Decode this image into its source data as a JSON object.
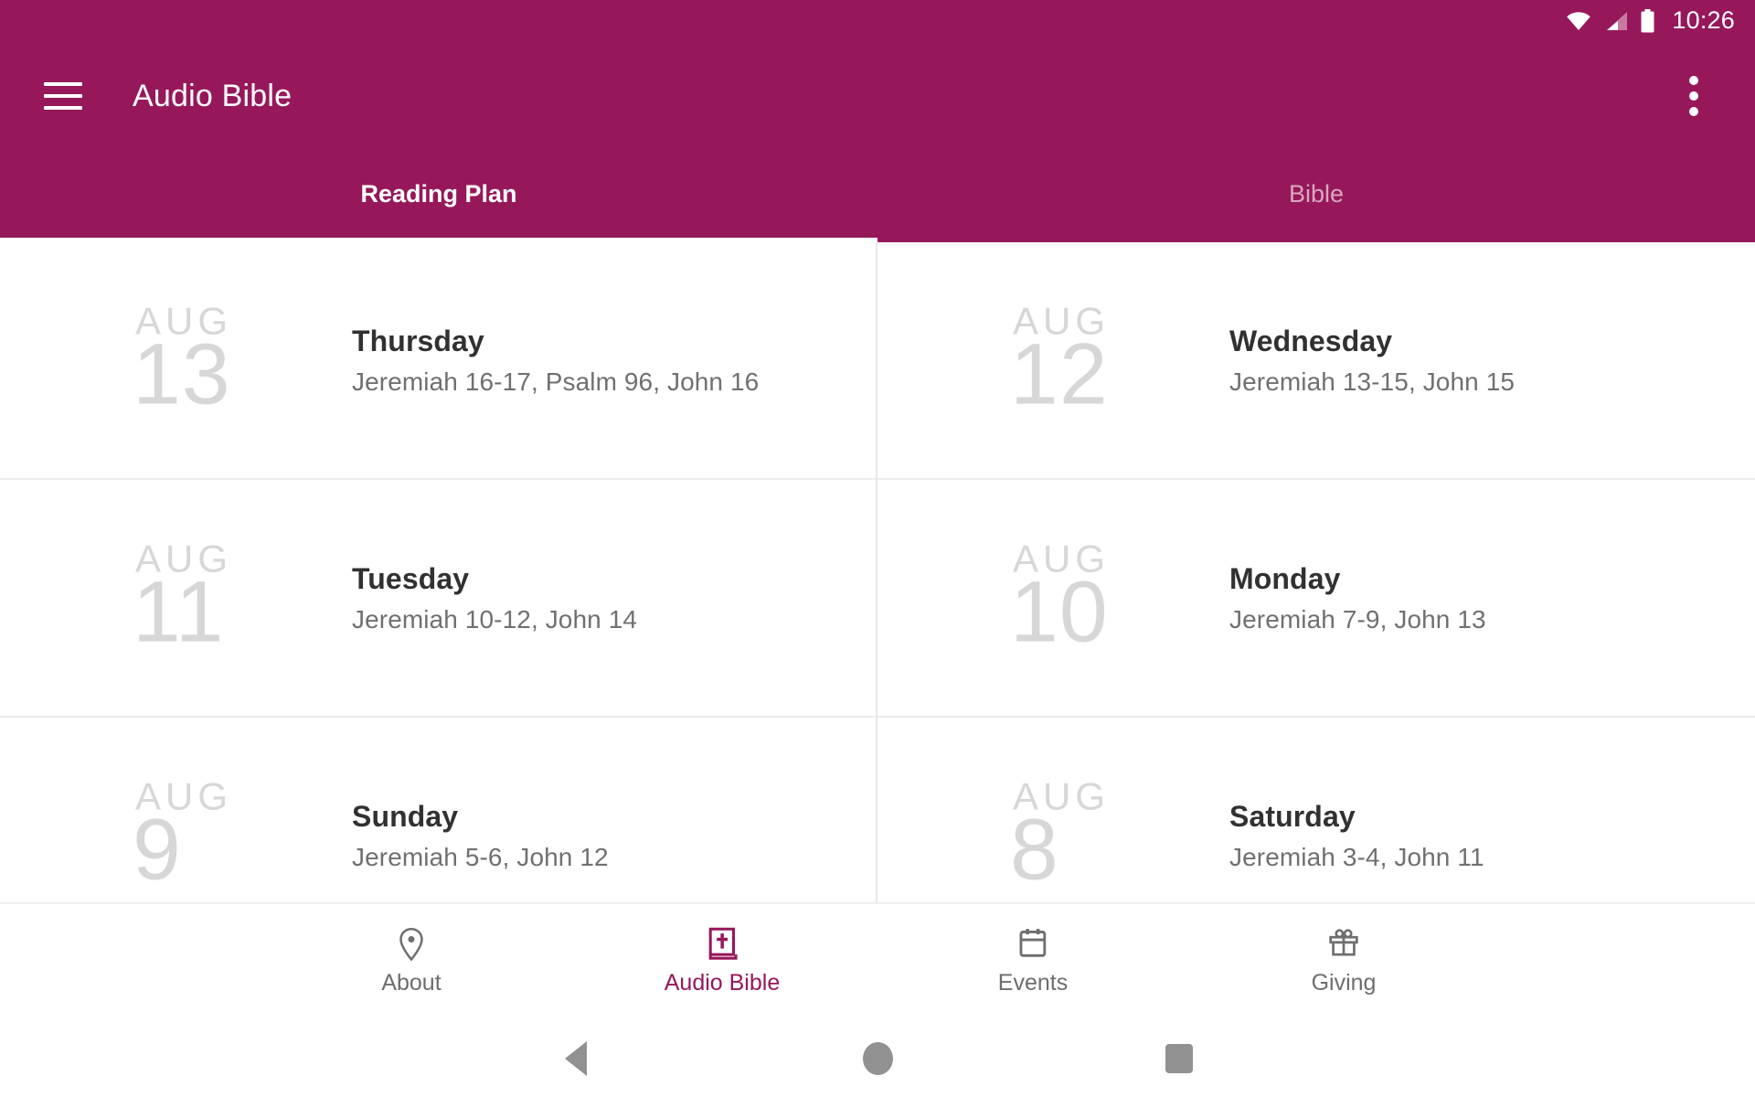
{
  "statusbar": {
    "time": "10:26",
    "icons": [
      "wifi-icon",
      "cellular-signal-icon",
      "battery-icon"
    ]
  },
  "toolbar": {
    "title": "Audio Bible",
    "menu_icon": "hamburger-menu-icon",
    "overflow_icon": "overflow-menu-icon",
    "background_color": "#96185B"
  },
  "tabs": {
    "items": [
      {
        "label": "Reading Plan",
        "active": true
      },
      {
        "label": "Bible",
        "active": false
      }
    ]
  },
  "reading_plan": {
    "entries": [
      {
        "month": "AUG",
        "day": "13",
        "weekday": "Thursday",
        "passages": "Jeremiah 16-17, Psalm 96, John 16"
      },
      {
        "month": "AUG",
        "day": "12",
        "weekday": "Wednesday",
        "passages": "Jeremiah 13-15, John 15"
      },
      {
        "month": "AUG",
        "day": "11",
        "weekday": "Tuesday",
        "passages": "Jeremiah 10-12, John 14"
      },
      {
        "month": "AUG",
        "day": "10",
        "weekday": "Monday",
        "passages": "Jeremiah 7-9, John 13"
      },
      {
        "month": "AUG",
        "day": "9",
        "weekday": "Sunday",
        "passages": "Jeremiah 5-6, John 12"
      },
      {
        "month": "AUG",
        "day": "8",
        "weekday": "Saturday",
        "passages": "Jeremiah 3-4, John 11"
      }
    ]
  },
  "bottom_nav": {
    "items": [
      {
        "label": "About",
        "icon": "location-pin-icon",
        "active": false
      },
      {
        "label": "Audio Bible",
        "icon": "bible-book-icon",
        "active": true
      },
      {
        "label": "Events",
        "icon": "calendar-icon",
        "active": false
      },
      {
        "label": "Giving",
        "icon": "gift-icon",
        "active": false
      }
    ],
    "active_color": "#96185B",
    "inactive_color": "#6E6E6E"
  },
  "system_nav": {
    "back": "back-triangle-icon",
    "home": "home-circle-icon",
    "recents": "recents-square-icon"
  }
}
